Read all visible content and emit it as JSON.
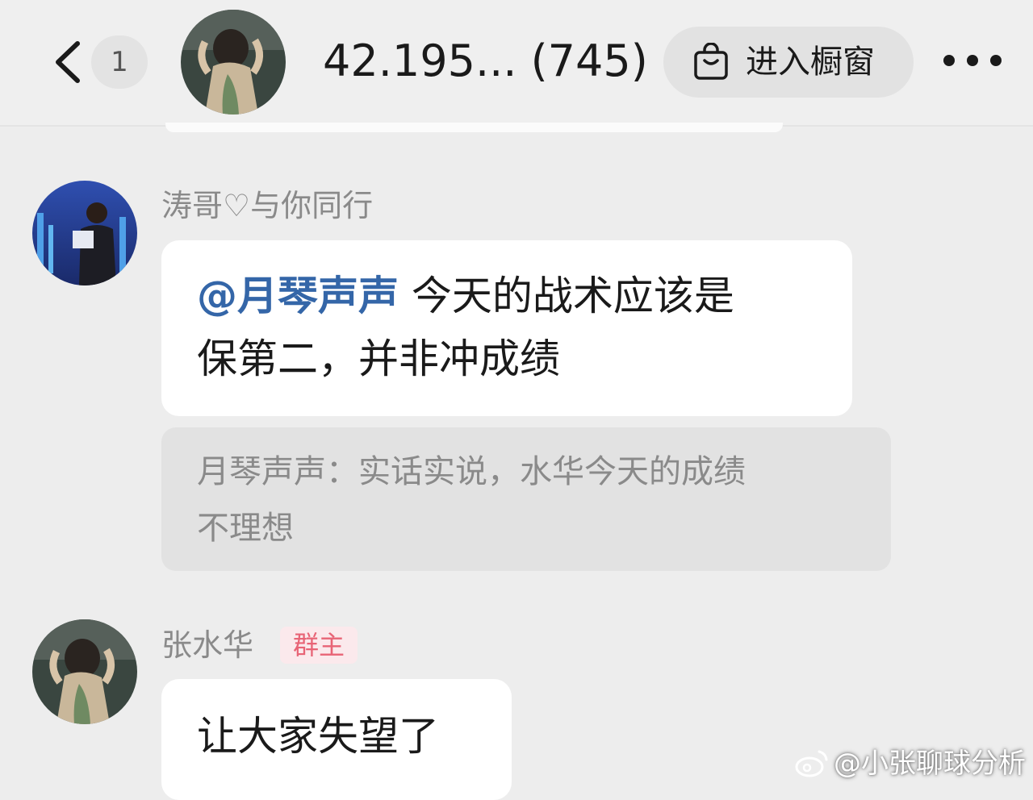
{
  "header": {
    "unread_count": "1",
    "title": "42.195... (745)",
    "shop_label": "进入橱窗"
  },
  "messages": [
    {
      "sender": "涛哥♡与你同行",
      "mention": "@月琴声声",
      "text_line1": "今天的战术应该是",
      "text_line2": "保第二，并非冲成绩",
      "quote_line1": "月琴声声：实话实说，水华今天的成绩",
      "quote_line2": "不理想"
    },
    {
      "sender": "张水华",
      "badge": "群主",
      "text": "让大家失望了"
    }
  ],
  "watermark": "@小张聊球分析"
}
